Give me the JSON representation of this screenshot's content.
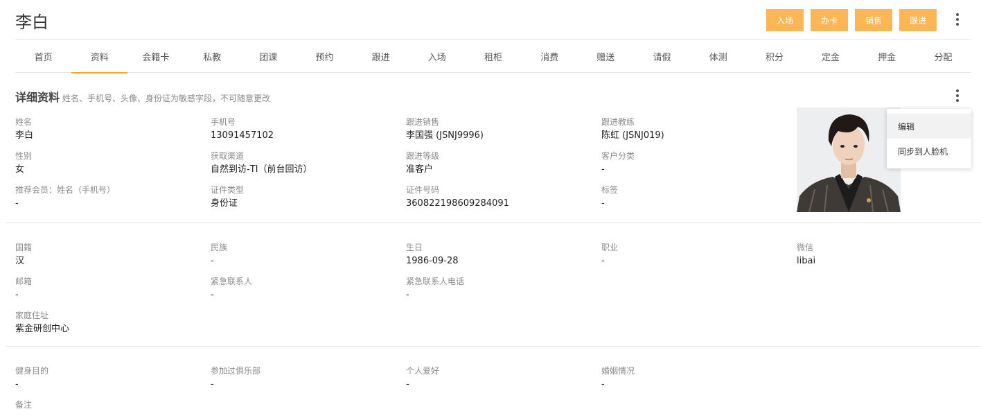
{
  "header": {
    "title": "李白",
    "actions": [
      "入场",
      "办卡",
      "销售",
      "跟进"
    ]
  },
  "tabs": [
    "首页",
    "资料",
    "会籍卡",
    "私教",
    "团课",
    "预约",
    "跟进",
    "入场",
    "租柜",
    "消费",
    "赠送",
    "请假",
    "体测",
    "积分",
    "定金",
    "押金",
    "分配"
  ],
  "active_tab": "资料",
  "section": {
    "title": "详细资料",
    "note": "姓名、手机号、头像、身份证为敏感字段，不可随意更改"
  },
  "context_menu": [
    "编辑",
    "同步到人脸机"
  ],
  "basic": {
    "name": {
      "label": "姓名",
      "value": "李白"
    },
    "phone": {
      "label": "手机号",
      "value": "13091457102"
    },
    "sales": {
      "label": "跟进销售",
      "value": "李国强 (JSNJ9996)"
    },
    "coach": {
      "label": "跟进教练",
      "value": "陈虹 (JSNJ019)"
    },
    "gender": {
      "label": "性别",
      "value": "女"
    },
    "channel": {
      "label": "获取渠道",
      "value": "自然到访-TI（前台回访）"
    },
    "level": {
      "label": "跟进等级",
      "value": "准客户"
    },
    "category": {
      "label": "客户分类",
      "value": "-"
    },
    "referrer": {
      "label": "推荐会员：姓名（手机号）",
      "value": "-"
    },
    "id_type": {
      "label": "证件类型",
      "value": "身份证"
    },
    "id_number": {
      "label": "证件号码",
      "value": "360822198609284091"
    },
    "tags": {
      "label": "标签",
      "value": "-"
    }
  },
  "extra": {
    "nationality": {
      "label": "国籍",
      "value": "汉"
    },
    "ethnicity": {
      "label": "民族",
      "value": "-"
    },
    "birthday": {
      "label": "生日",
      "value": "1986-09-28"
    },
    "job": {
      "label": "职业",
      "value": "-"
    },
    "wechat": {
      "label": "微信",
      "value": "libai"
    },
    "email": {
      "label": "邮箱",
      "value": "-"
    },
    "emergency": {
      "label": "紧急联系人",
      "value": "-"
    },
    "emergency_phone": {
      "label": "紧急联系人电话",
      "value": "-"
    },
    "address": {
      "label": "家庭住址",
      "value": "紫金研创中心"
    }
  },
  "more": {
    "goal": {
      "label": "健身目的",
      "value": "-"
    },
    "club": {
      "label": "参加过俱乐部",
      "value": "-"
    },
    "hobby": {
      "label": "个人爱好",
      "value": "-"
    },
    "marriage": {
      "label": "婚姻情况",
      "value": "-"
    },
    "remark": {
      "label": "备注",
      "value": ""
    }
  },
  "colors": {
    "accent": "#fdb655",
    "tab_underline": "#f5a623"
  }
}
